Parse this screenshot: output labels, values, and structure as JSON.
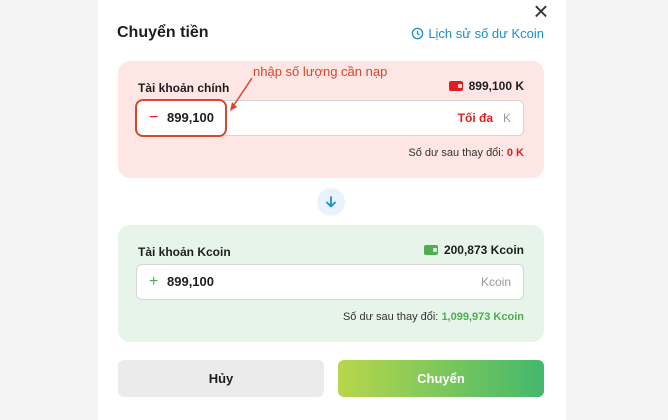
{
  "header": {
    "title": "Chuyển tiền",
    "history_link": "Lịch sử số dư Kcoin"
  },
  "annotation": {
    "text": "nhập số lượng cần nạp"
  },
  "main_account": {
    "label": "Tài khoản chính",
    "balance": "899,100 K",
    "sign": "−",
    "amount": "899,100",
    "max_label": "Tối đa",
    "unit": "K",
    "after_label": "Số dư sau thay đổi:",
    "after_value": "0 K"
  },
  "kcoin_account": {
    "label": "Tài khoản Kcoin",
    "balance": "200,873 Kcoin",
    "sign": "+",
    "amount": "899,100",
    "unit": "Kcoin",
    "after_label": "Số dư sau thay đổi:",
    "after_value": "1,099,973 Kcoin"
  },
  "actions": {
    "cancel_label": "Hủy",
    "confirm_label": "Chuyển"
  },
  "icons": {
    "close": "close-icon",
    "history": "history-icon",
    "wallet": "wallet-icon",
    "swap": "arrow-down-icon"
  },
  "colors": {
    "danger": "#e02020",
    "success": "#4caf50",
    "link": "#1a8fc9",
    "annotation": "#d9462b"
  }
}
